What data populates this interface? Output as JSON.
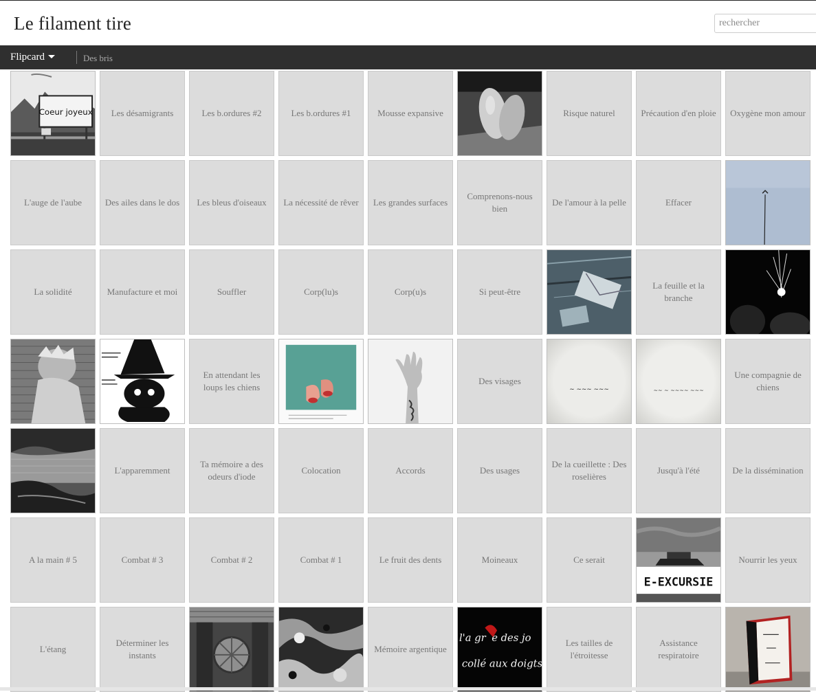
{
  "blog": {
    "title": "Le filament tire"
  },
  "search": {
    "placeholder": "rechercher"
  },
  "nav": {
    "view_label": "Flipcard",
    "link_label": "Des bris"
  },
  "rows": [
    [
      {
        "type": "image",
        "title": "",
        "icon": "photo-town-sign",
        "sign_text": "Coeur joyeux"
      },
      {
        "type": "text",
        "title": "Les désamigrants"
      },
      {
        "type": "text",
        "title": "Les b.ordures #2"
      },
      {
        "type": "text",
        "title": "Les b.ordures #1"
      },
      {
        "type": "text",
        "title": "Mousse expansive"
      },
      {
        "type": "image",
        "title": "",
        "icon": "photo-potatoes"
      },
      {
        "type": "text",
        "title": "Risque naturel"
      },
      {
        "type": "text",
        "title": "Précaution d'en ploie"
      },
      {
        "type": "text",
        "title": "Oxygène mon amour"
      }
    ],
    [
      {
        "type": "text",
        "title": "L'auge de l'aube"
      },
      {
        "type": "text",
        "title": "Des ailes dans le dos"
      },
      {
        "type": "text",
        "title": "Les bleus d'oiseaux"
      },
      {
        "type": "text",
        "title": "La nécessité de rêver"
      },
      {
        "type": "text",
        "title": "Les grandes surfaces"
      },
      {
        "type": "text",
        "title": "Comprenons-nous bien"
      },
      {
        "type": "text",
        "title": "De l'amour à la pelle"
      },
      {
        "type": "text",
        "title": "Effacer"
      },
      {
        "type": "image",
        "title": "",
        "icon": "photo-sky-bird"
      }
    ],
    [
      {
        "type": "text",
        "title": "La solidité"
      },
      {
        "type": "text",
        "title": "Manufacture et moi"
      },
      {
        "type": "text",
        "title": "Souffler"
      },
      {
        "type": "text",
        "title": "Corp(lu)s"
      },
      {
        "type": "text",
        "title": "Corp(u)s"
      },
      {
        "type": "text",
        "title": "Si peut-être"
      },
      {
        "type": "image",
        "title": "",
        "icon": "photo-envelope"
      },
      {
        "type": "text",
        "title": "La feuille et la branche"
      },
      {
        "type": "image",
        "title": "",
        "icon": "photo-fireworks"
      }
    ],
    [
      {
        "type": "image",
        "title": "",
        "icon": "photo-child-wall"
      },
      {
        "type": "image",
        "title": "",
        "icon": "photo-witch-cat"
      },
      {
        "type": "text",
        "title": "En attendant les loups les chiens"
      },
      {
        "type": "image",
        "title": "",
        "icon": "photo-polaroid-feet"
      },
      {
        "type": "image",
        "title": "",
        "icon": "photo-hand"
      },
      {
        "type": "text",
        "title": "Des visages"
      },
      {
        "type": "image",
        "title": "",
        "icon": "photo-handwriting-1"
      },
      {
        "type": "image",
        "title": "",
        "icon": "photo-handwriting-2"
      },
      {
        "type": "text",
        "title": "Une compagnie de chiens"
      }
    ],
    [
      {
        "type": "image",
        "title": "",
        "icon": "photo-river"
      },
      {
        "type": "text",
        "title": "L'apparemment"
      },
      {
        "type": "text",
        "title": "Ta mémoire a des odeurs d'iode"
      },
      {
        "type": "text",
        "title": "Colocation"
      },
      {
        "type": "text",
        "title": "Accords"
      },
      {
        "type": "text",
        "title": "Des usages"
      },
      {
        "type": "text",
        "title": "De la cueillette : Des roselières"
      },
      {
        "type": "text",
        "title": "Jusqu'à l'été"
      },
      {
        "type": "text",
        "title": "De la dissémination"
      }
    ],
    [
      {
        "type": "text",
        "title": "A la main # 5"
      },
      {
        "type": "text",
        "title": "Combat # 3"
      },
      {
        "type": "text",
        "title": "Combat # 2"
      },
      {
        "type": "text",
        "title": "Combat # 1"
      },
      {
        "type": "text",
        "title": "Le fruit des dents"
      },
      {
        "type": "text",
        "title": "Moineaux"
      },
      {
        "type": "text",
        "title": "Ce serait"
      },
      {
        "type": "image",
        "title": "",
        "icon": "photo-boat-excursion",
        "sign_text": "E-EXCURSIE"
      },
      {
        "type": "text",
        "title": "Nourrir les yeux"
      }
    ],
    [
      {
        "type": "text",
        "title": "L'étang"
      },
      {
        "type": "text",
        "title": "Déterminer les instants"
      },
      {
        "type": "image",
        "title": "",
        "icon": "photo-wood-wheel"
      },
      {
        "type": "image",
        "title": "",
        "icon": "photo-texture"
      },
      {
        "type": "text",
        "title": "Mémoire argentique"
      },
      {
        "type": "image",
        "title": "",
        "icon": "photo-red-writing"
      },
      {
        "type": "text",
        "title": "Les tailles de l'étroitesse"
      },
      {
        "type": "text",
        "title": "Assistance respiratoire"
      },
      {
        "type": "image",
        "title": "",
        "icon": "photo-card-book"
      }
    ]
  ]
}
